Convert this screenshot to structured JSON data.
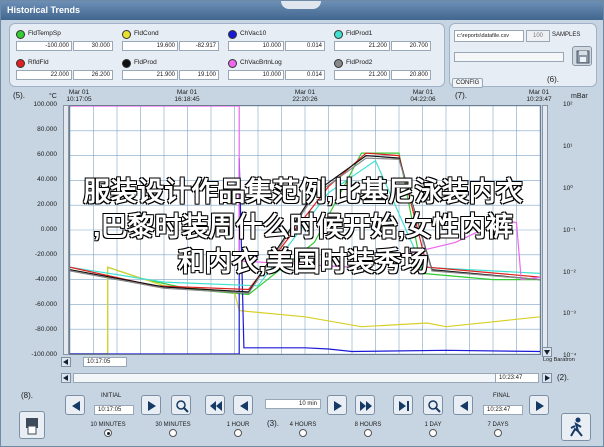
{
  "window": {
    "title": "Historical Trends"
  },
  "legend": [
    {
      "name": "FldTempSp",
      "color": "#33cc33",
      "min": "-100.000",
      "max": "30.000"
    },
    {
      "name": "FldCond",
      "color": "#e8e030",
      "min": "19.600",
      "max": "-82.917"
    },
    {
      "name": "ChVac10",
      "color": "#1a1ad6",
      "min": "10.000",
      "max": "0.014"
    },
    {
      "name": "FldProd1",
      "color": "#40e0d0",
      "min": "21.200",
      "max": "20.700"
    },
    {
      "name": "RfldFld",
      "color": "#e02020",
      "min": "22.000",
      "max": "26.200"
    },
    {
      "name": "FldProd",
      "color": "#111111",
      "min": "21.900",
      "max": "19.100"
    },
    {
      "name": "ChVacBrtnLog",
      "color": "#ee66ee",
      "min": "10.000",
      "max": "0.014"
    },
    {
      "name": "FldProd2",
      "color": "#888888",
      "min": "21.200",
      "max": "20.800"
    }
  ],
  "config": {
    "path": "c:\\reports\\datafile.csv",
    "samples_value": "100",
    "samples_label": "SAMPLES",
    "config_label": "CONFIG",
    "save_icon": "disk-icon"
  },
  "callouts": {
    "c1": "(1).",
    "c2": "(2).",
    "c3": "(3).",
    "c5": "(5).",
    "c6": "(6).",
    "c7": "(7).",
    "c8": "(8)."
  },
  "chart": {
    "left_unit": "°C",
    "right_unit": "mBar",
    "times": [
      {
        "date": "Mar 01",
        "time": "10:17:05"
      },
      {
        "date": "Mar 01",
        "time": "16:18:45"
      },
      {
        "date": "Mar 01",
        "time": "22:20:26"
      },
      {
        "date": "Mar 01",
        "time": "04:22:06"
      },
      {
        "date": "Mar 01",
        "time": "10:23:47"
      }
    ],
    "start_field": "10:17:05",
    "end_field": "10:23:47",
    "right_axis_label": "Log Baratron"
  },
  "chart_data": {
    "type": "line",
    "y_left": {
      "ticks": [
        "100.000",
        "80.000",
        "60.000",
        "40.000",
        "20.000",
        "0.000",
        "-20.000",
        "-40.000",
        "-60.000",
        "-80.000",
        "-100.000"
      ],
      "range": [
        -100,
        100
      ]
    },
    "y_right": {
      "ticks": [
        "10²",
        "10¹",
        "10⁰",
        "10⁻¹",
        "10⁻²",
        "10⁻³",
        "10⁻⁴"
      ],
      "range_log10": [
        -4,
        2
      ]
    },
    "series": [
      {
        "name": "FldTempSp",
        "color": "#33cc33",
        "points": [
          [
            0,
            -100
          ],
          [
            0.08,
            -100
          ],
          [
            0.08,
            -30
          ],
          [
            0.16,
            -40
          ],
          [
            0.26,
            -48
          ],
          [
            0.38,
            -52
          ],
          [
            0.52,
            -10
          ],
          [
            0.62,
            62
          ],
          [
            0.7,
            62
          ],
          [
            0.75,
            -35
          ],
          [
            0.9,
            -40
          ],
          [
            1,
            -40
          ]
        ]
      },
      {
        "name": "FldCond",
        "color": "#d8d028",
        "points": [
          [
            0,
            -100
          ],
          [
            0.08,
            -100
          ],
          [
            0.08,
            -30
          ],
          [
            0.2,
            -45
          ],
          [
            0.35,
            -50
          ],
          [
            0.36,
            -65
          ],
          [
            0.5,
            -70
          ],
          [
            0.62,
            -78
          ],
          [
            0.76,
            -75
          ],
          [
            0.8,
            -78
          ],
          [
            0.9,
            -74
          ],
          [
            1,
            -70
          ]
        ]
      },
      {
        "name": "ChVac10",
        "color": "#1a1ad6",
        "points": [
          [
            0,
            -100
          ],
          [
            0.36,
            -100
          ],
          [
            0.36,
            58
          ],
          [
            0.37,
            -95
          ],
          [
            0.5,
            -95
          ],
          [
            0.55,
            -96
          ],
          [
            0.6,
            -98
          ],
          [
            0.8,
            -97
          ],
          [
            1,
            -98
          ]
        ]
      },
      {
        "name": "FldProd1",
        "color": "#40e0d0",
        "points": [
          [
            0,
            -30
          ],
          [
            0.2,
            -42
          ],
          [
            0.4,
            -45
          ],
          [
            0.55,
            30
          ],
          [
            0.65,
            56
          ],
          [
            0.75,
            -30
          ],
          [
            1,
            -35
          ]
        ]
      },
      {
        "name": "RfldFld",
        "color": "#e02020",
        "points": [
          [
            0,
            -30
          ],
          [
            0.18,
            -45
          ],
          [
            0.38,
            -48
          ],
          [
            0.55,
            35
          ],
          [
            0.63,
            62
          ],
          [
            0.7,
            60
          ],
          [
            0.76,
            -30
          ],
          [
            1,
            -38
          ]
        ]
      },
      {
        "name": "FldProd",
        "color": "#111111",
        "points": [
          [
            0,
            -32
          ],
          [
            0.2,
            -46
          ],
          [
            0.38,
            -50
          ],
          [
            0.52,
            30
          ],
          [
            0.63,
            60
          ],
          [
            0.7,
            58
          ],
          [
            0.77,
            -32
          ],
          [
            1,
            -40
          ]
        ]
      },
      {
        "name": "ChVacBrtnLog",
        "color": "#ee66ee",
        "points": [
          [
            0,
            100
          ],
          [
            0.36,
            100
          ],
          [
            0.36,
            -25
          ],
          [
            0.6,
            -30
          ],
          [
            0.82,
            -10
          ],
          [
            0.92,
            8
          ],
          [
            0.95,
            6
          ],
          [
            0.96,
            -40
          ],
          [
            1,
            -38
          ]
        ]
      },
      {
        "name": "FldProd2",
        "color": "#888888",
        "points": [
          [
            0,
            -33
          ],
          [
            0.2,
            -47
          ],
          [
            0.38,
            -51
          ],
          [
            0.52,
            28
          ],
          [
            0.63,
            58
          ],
          [
            0.7,
            57
          ],
          [
            0.77,
            -33
          ],
          [
            1,
            -40
          ]
        ]
      }
    ]
  },
  "nav": {
    "initial_label": "INITIAL",
    "initial_time": "10:17:05",
    "final_label": "FINAL",
    "final_time": "10:23:47",
    "span_field": "10 min",
    "ranges": [
      "10 MINUTES",
      "30 MINUTES",
      "1 HOUR",
      "4 HOURS",
      "8 HOURS",
      "1 DAY",
      "7 DAYS"
    ],
    "selected_range": "10 MINUTES"
  },
  "watermark": {
    "line1": "服装设计作品集范例,比基尼泳装内衣",
    "line2": ",巴黎时装周什么时候开始,女性内裤",
    "line3": "和内衣,美国时装秀场"
  }
}
